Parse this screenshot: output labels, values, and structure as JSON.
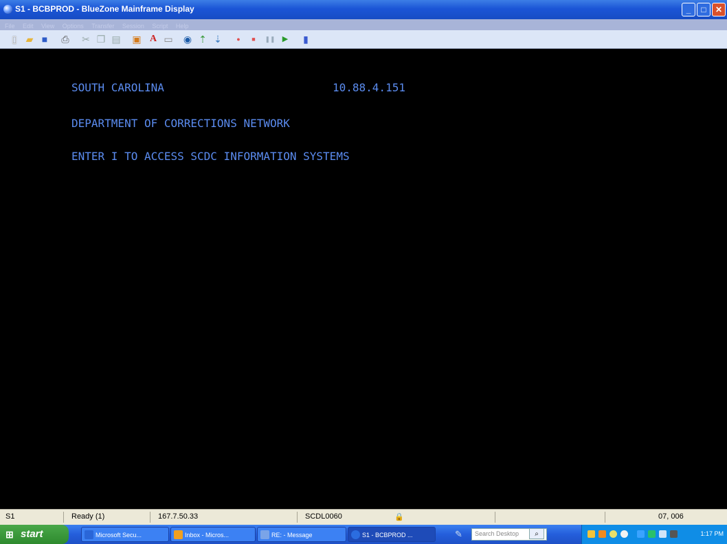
{
  "window": {
    "title": "S1 - BCBPROD - BlueZone Mainframe Display",
    "menu": [
      "File",
      "Edit",
      "View",
      "Options",
      "Transfer",
      "Session",
      "Script",
      "Help"
    ]
  },
  "toolbar_icons": [
    "new-icon",
    "open-icon",
    "save-icon",
    "print-icon",
    "cut-icon",
    "copy-icon",
    "paste-icon",
    "session-icon",
    "font-icon",
    "display-icon",
    "connect-icon",
    "send-icon",
    "receive-icon",
    "record-icon",
    "stop-icon",
    "pause-icon",
    "play-icon",
    "script-icon"
  ],
  "terminal": {
    "line1_left": "SOUTH CAROLINA",
    "line1_right": "10.88.4.151",
    "line2": "DEPARTMENT OF CORRECTIONS NETWORK",
    "line3": "ENTER I TO ACCESS SCDC INFORMATION SYSTEMS"
  },
  "status": {
    "session": "S1",
    "state": "Ready (1)",
    "ip": "167.7.50.33",
    "lu": "SCDL0060",
    "cursor": "07, 006"
  },
  "taskbar": {
    "start_label": "start",
    "tasks": [
      "Microsoft Secu...",
      "Inbox - Micros...",
      "RE: - Message",
      "S1 - BCBPROD ..."
    ],
    "search_placeholder": "Search Desktop",
    "clock": "1:17 PM"
  }
}
